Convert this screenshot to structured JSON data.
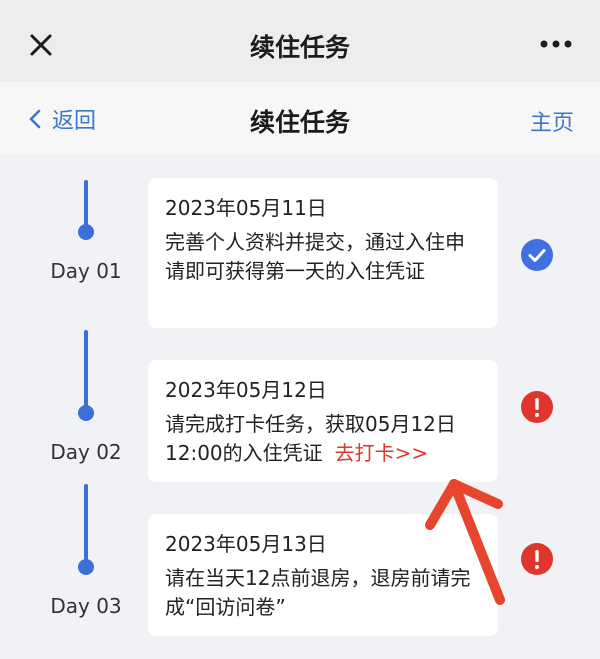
{
  "topbar": {
    "title": "续住任务",
    "close_icon": "close-icon",
    "more_icon": "more-icon"
  },
  "navbar": {
    "back_label": "返回",
    "title": "续住任务",
    "home_label": "主页"
  },
  "tasks": [
    {
      "day": "Day 01",
      "date": "2023年05月11日",
      "description": "完善个人资料并提交，通过入住申请即可获得第一天的入住凭证",
      "status": "completed",
      "status_icon": "check-circle-icon"
    },
    {
      "day": "Day 02",
      "date": "2023年05月12日",
      "description": "请完成打卡任务，获取05月12日12:00的入住凭证",
      "action_link": "去打卡>>",
      "status": "pending",
      "status_icon": "alert-circle-icon"
    },
    {
      "day": "Day 03",
      "date": "2023年05月13日",
      "description": "请在当天12点前退房，退房前请完成“回访问卷”",
      "status": "pending",
      "status_icon": "alert-circle-icon"
    }
  ],
  "colors": {
    "accent": "#3d6fd8",
    "link": "#3a78c8",
    "alert": "#e0352b",
    "annotation_arrow": "#e8452f"
  }
}
